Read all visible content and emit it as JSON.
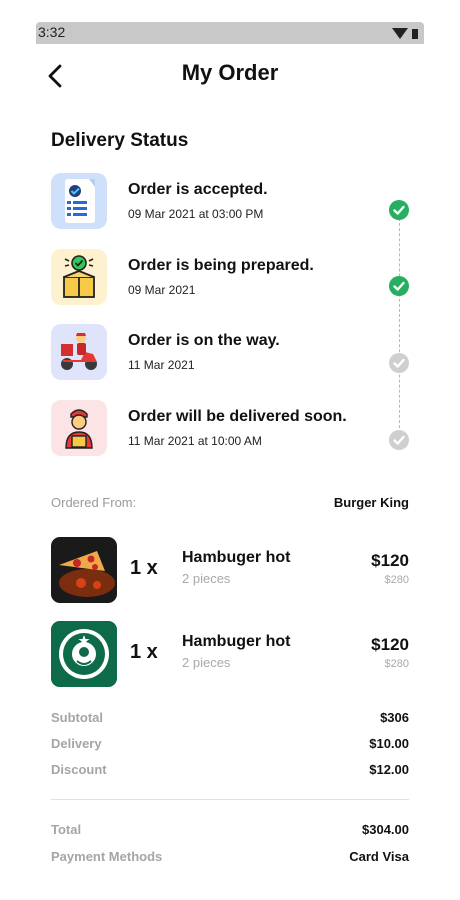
{
  "status_bar": {
    "time": "3:32"
  },
  "header": {
    "title": "My Order"
  },
  "delivery": {
    "title": "Delivery Status",
    "steps": [
      {
        "title": "Order is accepted.",
        "date": "09 Mar 2021 at 03:00 PM",
        "done": true
      },
      {
        "title": "Order is being prepared.",
        "date": "09 Mar 2021",
        "done": true
      },
      {
        "title": "Order is on the way.",
        "date": "11 Mar 2021",
        "done": false
      },
      {
        "title": "Order will be delivered soon.",
        "date": "11 Mar 2021 at 10:00 AM",
        "done": false
      }
    ]
  },
  "ordered_from": {
    "label": "Ordered From:",
    "value": "Burger King"
  },
  "items": [
    {
      "qty": "1 x",
      "name": "Hambuger hot",
      "pieces": "2 pieces",
      "price": "$120",
      "old_price": "$280"
    },
    {
      "qty": "1 x",
      "name": "Hambuger hot",
      "pieces": "2 pieces",
      "price": "$120",
      "old_price": "$280"
    }
  ],
  "summary": {
    "subtotal": {
      "label": "Subtotal",
      "value": "$306"
    },
    "delivery": {
      "label": "Delivery",
      "value": "$10.00"
    },
    "discount": {
      "label": "Discount",
      "value": "$12.00"
    },
    "total": {
      "label": "Total",
      "value": "$304.00"
    },
    "payment": {
      "label": "Payment Methods",
      "value": "Card Visa"
    }
  },
  "colors": {
    "done": "#27ae60",
    "pending": "#cfcfcf",
    "starbucks": "#0d6b4a"
  }
}
